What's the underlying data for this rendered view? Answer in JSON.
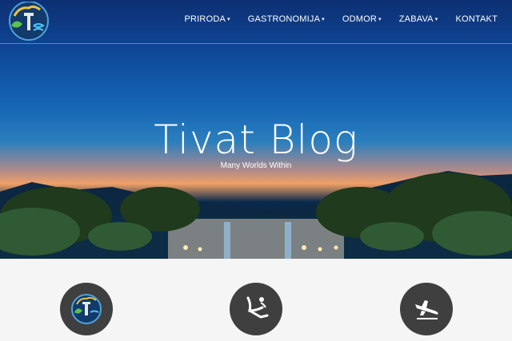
{
  "nav": {
    "items": [
      {
        "label": "PRIRODA",
        "has_dropdown": true
      },
      {
        "label": "GASTRONOMIJA",
        "has_dropdown": true
      },
      {
        "label": "ODMOR",
        "has_dropdown": true
      },
      {
        "label": "ZABAVA",
        "has_dropdown": true
      },
      {
        "label": "KONTAKT",
        "has_dropdown": false
      }
    ],
    "caret": "▾"
  },
  "logo": {
    "icon": "tivat-logo-icon"
  },
  "hero": {
    "title": "Tivat Blog",
    "subtitle": "Many Worlds Within"
  },
  "features": [
    {
      "icon": "tivat-logo-icon"
    },
    {
      "icon": "swimmer-icon"
    },
    {
      "icon": "airplane-landing-icon"
    }
  ],
  "colors": {
    "sky_top": "#0d2f73",
    "sunset": "#f0a067",
    "circle_bg": "#3f3f3f",
    "nav_text": "#ffffff"
  }
}
